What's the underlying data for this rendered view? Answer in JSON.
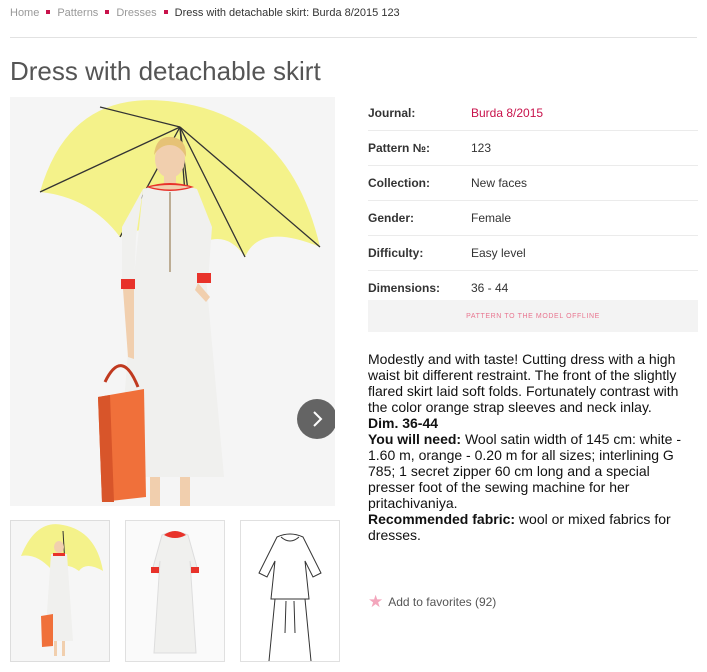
{
  "breadcrumb": {
    "home": "Home",
    "patterns": "Patterns",
    "dresses": "Dresses",
    "current": "Dress with detachable skirt: Burda 8/2015 123"
  },
  "title": "Dress with detachable skirt",
  "properties": [
    {
      "label": "Journal:",
      "value": "Burda 8/2015"
    },
    {
      "label": "Pattern №:",
      "value": "123"
    },
    {
      "label": "Collection:",
      "value": "New faces"
    },
    {
      "label": "Gender:",
      "value": "Female"
    },
    {
      "label": "Difficulty:",
      "value": "Easy level"
    },
    {
      "label": "Dimensions:",
      "value": "36 - 44"
    }
  ],
  "offline_button": "PATTERN TO THE MODEL OFFLINE",
  "description": {
    "text": "Modestly and with taste! Cutting dress with a high waist bit different restraint. The front of the slightly flared skirt laid soft folds. Fortunately contrast with the color orange strap sleeves and neck inlay.",
    "dim": "Dim. 36-44",
    "need_label": "You will need:",
    "need_text": " Wool satin width of 145 cm: white - 1.60 m, orange - 0.20 m for all sizes; interlining G 785; 1 secret zipper 60 cm long and a special presser foot of the sewing machine for her pritachivaniya.",
    "fabric_label": "Recommended fabric:",
    "fabric_text": " wool or mixed fabrics for dresses."
  },
  "favorites": "Add to favorites (92)",
  "colors": {
    "accent": "#c8124b",
    "umbrella": "#f4f28a",
    "trim": "#e8322a",
    "dress": "#f2f2f0"
  },
  "icons": {
    "next": "chevron-right-icon",
    "favorite": "star-icon"
  }
}
